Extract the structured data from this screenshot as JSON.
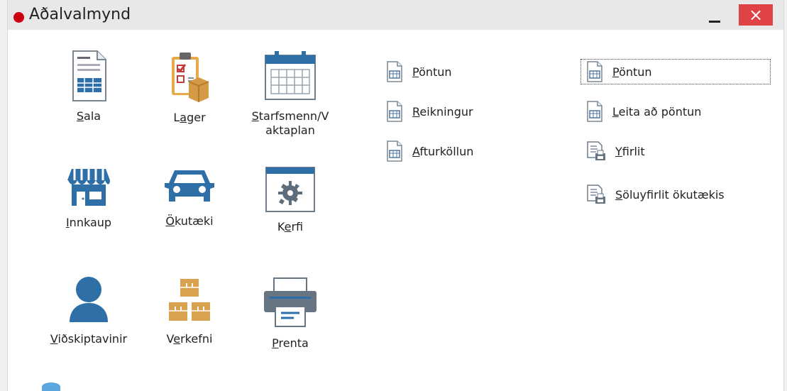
{
  "window": {
    "title": "Aðalvalmynd",
    "close_label": "×"
  },
  "apps": [
    {
      "pre": "",
      "u": "S",
      "post": "ala",
      "line2": ""
    },
    {
      "pre": "L",
      "u": "a",
      "post": "ger",
      "line2": ""
    },
    {
      "pre": "",
      "u": "S",
      "post": "tarfsmenn/V",
      "line2": "aktaplan"
    },
    {
      "pre": "",
      "u": "I",
      "post": "nnkaup",
      "line2": ""
    },
    {
      "pre": "",
      "u": "Ö",
      "post": "kutæki",
      "line2": ""
    },
    {
      "pre": "K",
      "u": "e",
      "post": "rfi",
      "line2": ""
    },
    {
      "pre": "",
      "u": "V",
      "post": "iðskiptavinir",
      "line2": ""
    },
    {
      "pre": "V",
      "u": "e",
      "post": "rkefni",
      "line2": ""
    },
    {
      "pre": "",
      "u": "P",
      "post": "renta",
      "line2": ""
    }
  ],
  "middle_links": [
    {
      "pre": "",
      "u": "P",
      "post": "öntun"
    },
    {
      "pre": "",
      "u": "R",
      "post": "eikningur"
    },
    {
      "pre": "",
      "u": "A",
      "post": "fturköllun"
    }
  ],
  "right_links": [
    {
      "pre": "",
      "u": "P",
      "post": "öntun"
    },
    {
      "pre": "",
      "u": "L",
      "post": "eita að pöntun"
    },
    {
      "pre": "",
      "u": "Y",
      "post": "firlit"
    },
    {
      "pre": "",
      "u": "S",
      "post": "öluyfirlit ökutækis"
    }
  ],
  "colors": {
    "close_bg": "#e04343",
    "icon_blue": "#2f6fa8",
    "icon_box": "#d8a24f"
  }
}
